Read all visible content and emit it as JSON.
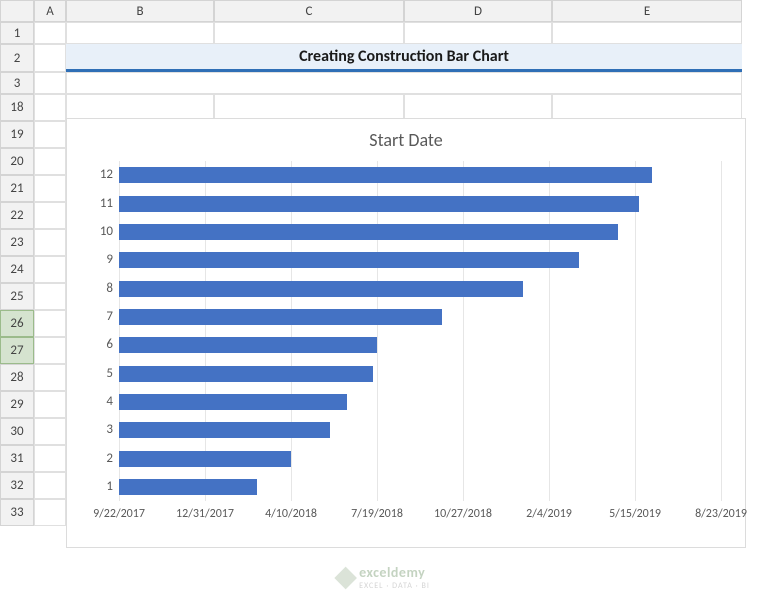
{
  "columns": [
    "A",
    "B",
    "C",
    "D",
    "E"
  ],
  "rows": [
    "1",
    "2",
    "3",
    "18",
    "19",
    "20",
    "21",
    "22",
    "23",
    "24",
    "25",
    "26",
    "27",
    "28",
    "29",
    "30",
    "31",
    "32",
    "33"
  ],
  "selected_row": "27",
  "banner_title": "Creating Construction Bar Chart",
  "chart_data": {
    "type": "bar",
    "title": "Start Date",
    "orientation": "horizontal",
    "categories": [
      "12",
      "11",
      "10",
      "9",
      "8",
      "7",
      "6",
      "5",
      "4",
      "3",
      "2",
      "1"
    ],
    "x_ticks": [
      "9/22/2017",
      "12/31/2017",
      "4/10/2018",
      "7/19/2018",
      "10/27/2018",
      "2/4/2019",
      "5/15/2019",
      "8/23/2019"
    ],
    "x_min_serial": 43000,
    "x_max_serial": 43700,
    "tick_interval": 100,
    "series": [
      {
        "name": "Start Date",
        "color": "#4472c4",
        "values_serial": [
          43620,
          43605,
          43580,
          43535,
          43470,
          43375,
          43300,
          43295,
          43265,
          43245,
          43200,
          43160
        ],
        "values_date": [
          "6/4/2019",
          "5/20/2019",
          "4/25/2019",
          "3/11/2019",
          "1/5/2019",
          "10/2/2018",
          "7/19/2018",
          "7/14/2018",
          "6/14/2018",
          "5/25/2018",
          "4/10/2018",
          "3/1/2018"
        ]
      }
    ],
    "xlabel": "",
    "ylabel": ""
  },
  "watermark": {
    "brand": "exceldemy",
    "tagline": "EXCEL · DATA · BI"
  }
}
